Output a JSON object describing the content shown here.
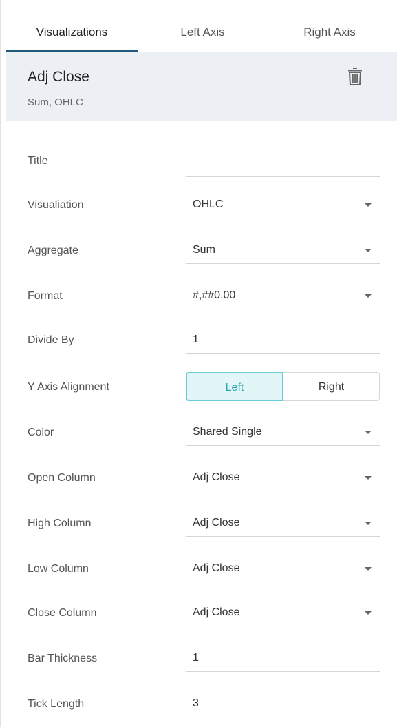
{
  "tabs": [
    {
      "label": "Visualizations",
      "active": true
    },
    {
      "label": "Left Axis",
      "active": false
    },
    {
      "label": "Right Axis",
      "active": false
    }
  ],
  "header": {
    "title": "Adj Close",
    "subtitle": "Sum, OHLC",
    "icon": "trash-icon"
  },
  "fields": {
    "title": {
      "label": "Title",
      "value": ""
    },
    "visualization": {
      "label": "Visualiation",
      "value": "OHLC"
    },
    "aggregate": {
      "label": "Aggregate",
      "value": "Sum"
    },
    "format": {
      "label": "Format",
      "value": "#,##0.00"
    },
    "divide_by": {
      "label": "Divide By",
      "value": "1"
    },
    "y_axis_alignment": {
      "label": "Y Axis Alignment",
      "options": [
        "Left",
        "Right"
      ],
      "selected": "Left"
    },
    "color": {
      "label": "Color",
      "value": "Shared Single"
    },
    "open_column": {
      "label": "Open Column",
      "value": "Adj Close"
    },
    "high_column": {
      "label": "High Column",
      "value": "Adj Close"
    },
    "low_column": {
      "label": "Low Column",
      "value": "Adj Close"
    },
    "close_column": {
      "label": "Close Column",
      "value": "Adj Close"
    },
    "bar_thickness": {
      "label": "Bar Thickness",
      "value": "1"
    },
    "tick_length": {
      "label": "Tick Length",
      "value": "3"
    }
  },
  "colors": {
    "tab_underline": "#1f5a7a",
    "header_bg": "#eceff3",
    "toggle_selected_bg": "#e2f6f7",
    "toggle_selected_border": "#69cfd6",
    "toggle_selected_text": "#2aa7b0"
  }
}
